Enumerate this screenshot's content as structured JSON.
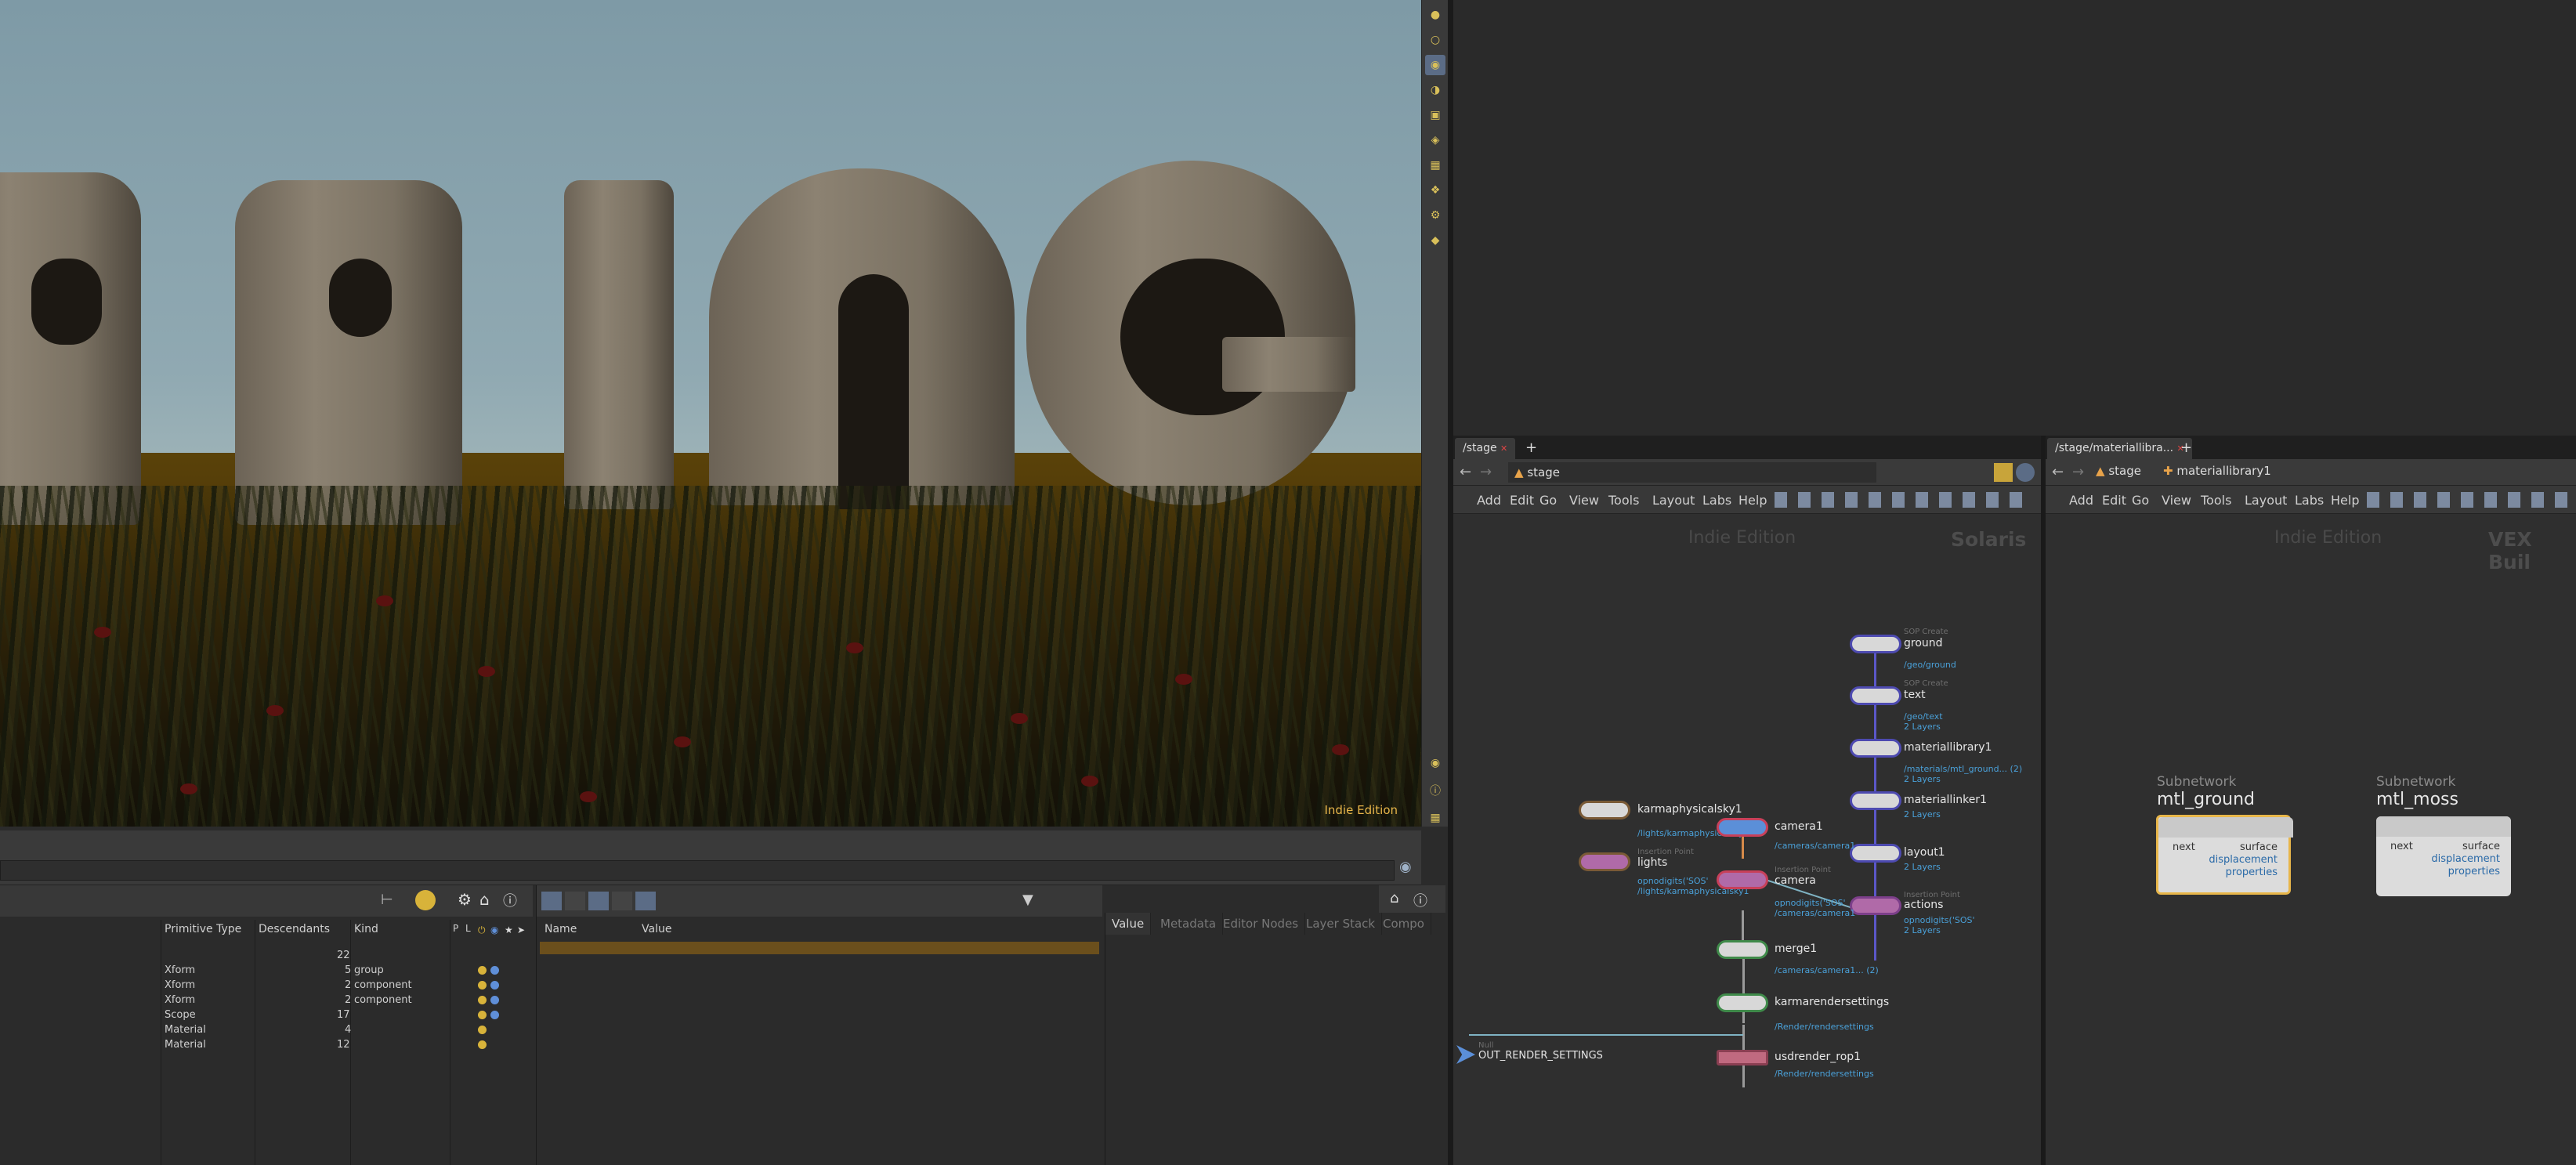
{
  "viewport": {
    "watermark": "Indie Edition"
  },
  "scene_graph": {
    "columns": [
      "Primitive Type",
      "Descendants",
      "Kind",
      "P",
      "L"
    ],
    "rows": [
      {
        "type": "",
        "descendants": "22",
        "kind": ""
      },
      {
        "type": "Xform",
        "descendants": "5",
        "kind": "group"
      },
      {
        "type": "Xform",
        "descendants": "2",
        "kind": "component"
      },
      {
        "type": "Xform",
        "descendants": "2",
        "kind": "component"
      },
      {
        "type": "Scope",
        "descendants": "17",
        "kind": ""
      },
      {
        "type": "Material",
        "descendants": "4",
        "kind": ""
      },
      {
        "type": "Material",
        "descendants": "12",
        "kind": ""
      }
    ]
  },
  "details_table": {
    "columns": [
      "Name",
      "Value"
    ]
  },
  "value_panel": {
    "tabs": [
      "Value",
      "Metadata",
      "Editor Nodes",
      "Layer Stack",
      "Compo"
    ]
  },
  "stage_pane": {
    "tab_label": "/stage",
    "path": "stage",
    "menu": [
      "Add",
      "Edit",
      "Go",
      "View",
      "Tools",
      "Layout",
      "Labs",
      "Help"
    ],
    "watermark": "Indie Edition",
    "context": "Solaris",
    "nodes": [
      {
        "name": "ground",
        "type": "SOP Create",
        "sub": "/geo/ground"
      },
      {
        "name": "text",
        "type": "SOP Create",
        "sub": "/geo/text",
        "sub2": "2 Layers"
      },
      {
        "name": "materiallibrary1",
        "sub": "/materials/mtl_ground... (2)",
        "sub2": "2 Layers"
      },
      {
        "name": "materiallinker1",
        "sub": "2 Layers"
      },
      {
        "name": "layout1",
        "sub": "2 Layers"
      },
      {
        "name": "actions",
        "type": "Insertion Point",
        "sub": "opnodigits('SOS'",
        "sub2": "2 Layers"
      },
      {
        "name": "karmaphysicalsky1",
        "sub": "/lights/karmaphysicalsky1"
      },
      {
        "name": "lights",
        "type": "Insertion Point",
        "sub": "opnodigits('SOS'",
        "sub2": "/lights/karmaphysicalsky1"
      },
      {
        "name": "camera1",
        "sub": "/cameras/camera1"
      },
      {
        "name": "camera",
        "type": "Insertion Point",
        "sub": "opnodigits('SOS'",
        "sub2": "/cameras/camera1"
      },
      {
        "name": "merge1",
        "sub": "/cameras/camera1... (2)"
      },
      {
        "name": "karmarendersettings",
        "sub": "/Render/rendersettings"
      },
      {
        "name": "usdrender_rop1",
        "sub": "/Render/rendersettings"
      },
      {
        "name": "OUT_RENDER_SETTINGS",
        "type": "Null"
      }
    ]
  },
  "matlib_pane": {
    "tab_label": "/stage/materiallibra...",
    "path1": "stage",
    "path2": "materiallibrary1",
    "menu": [
      "Add",
      "Edit",
      "Go",
      "View",
      "Tools",
      "Layout",
      "Labs",
      "Help"
    ],
    "watermark": "Indie Edition",
    "context": "VEX Buil",
    "subnets": [
      {
        "kind": "Subnetwork",
        "name": "mtl_ground",
        "in": "next",
        "outs": [
          "surface",
          "displacement",
          "properties"
        ]
      },
      {
        "kind": "Subnetwork",
        "name": "mtl_moss",
        "in": "next",
        "outs": [
          "surface",
          "displacement",
          "properties"
        ]
      }
    ]
  },
  "colors": {
    "accent_yellow": "#e8b64a",
    "node_border": "#4d4ab0",
    "sub_text": "#4aa0d8"
  }
}
